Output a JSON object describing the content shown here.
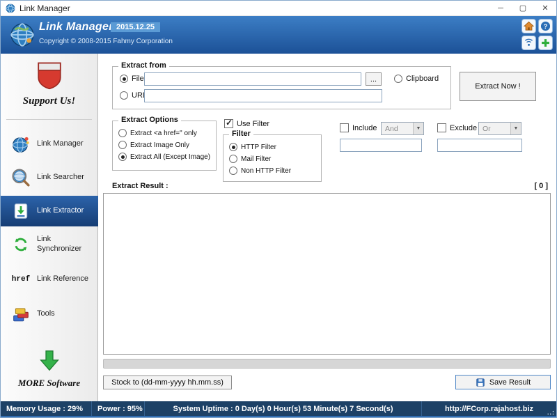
{
  "colors": {
    "header_top": "#3c7ec5",
    "header_bottom": "#1c5197",
    "selected_item": "#1f4d8c",
    "status_bar": "#1d4166",
    "version_badge": "#5b9bd5",
    "support_red": "#d63a2f",
    "arrow_green": "#35b24a"
  },
  "titlebar": {
    "title": "Link Manager",
    "minimize": "─",
    "maximize": "▢",
    "close": "✕"
  },
  "header": {
    "title": "Link Manager",
    "version": "2015.12.25",
    "copyright": "Copyright © 2008-2015 Fahmy Corporation"
  },
  "sidebar": {
    "support_label": "Support Us!",
    "href_glyph": "href",
    "items": [
      {
        "label": "Link Manager",
        "icon": "globe-icon",
        "selected": false
      },
      {
        "label": "Link Searcher",
        "icon": "magnifier-icon",
        "selected": false
      },
      {
        "label": "Link Extractor",
        "icon": "extract-icon",
        "selected": true
      },
      {
        "label": "Link Synchronizer",
        "icon": "sync-icon",
        "selected": false
      },
      {
        "label": "Link Reference",
        "icon": "href-icon",
        "selected": false
      },
      {
        "label": "Tools",
        "icon": "tools-icon",
        "selected": false
      }
    ],
    "more_label": "MORE Software"
  },
  "extract_from": {
    "legend": "Extract from",
    "file_label": "File",
    "file_value": "",
    "browse_label": "...",
    "url_label": "URL",
    "url_value": "",
    "clipboard_label": "Clipboard",
    "extract_now_label": "Extract Now !"
  },
  "extract_options": {
    "legend": "Extract Options",
    "options": [
      {
        "label": "Extract <a href=\" only",
        "selected": false
      },
      {
        "label": "Extract Image Only",
        "selected": false
      },
      {
        "label": "Extract All (Except Image)",
        "selected": true
      }
    ]
  },
  "filter": {
    "use_filter_label": "Use Filter",
    "use_filter_checked": true,
    "legend": "Filter",
    "options": [
      {
        "label": "HTTP Filter",
        "selected": true
      },
      {
        "label": "Mail Filter",
        "selected": false
      },
      {
        "label": "Non HTTP Filter",
        "selected": false
      }
    ]
  },
  "include": {
    "label": "Include",
    "operator": "And",
    "value": ""
  },
  "exclude": {
    "label": "Exclude",
    "operator": "Or",
    "value": ""
  },
  "result": {
    "label": "Extract Result :",
    "count": "[ 0 ]"
  },
  "actions": {
    "stock_label": "Stock to (dd-mm-yyyy hh.mm.ss)",
    "save_label": "Save Result"
  },
  "statusbar": {
    "memory": "Memory Usage : 29%",
    "power": "Power : 95%",
    "uptime": "System Uptime : 0 Day(s) 0 Hour(s) 53 Minute(s) 7 Second(s)",
    "url": "http://FCorp.rajahost.biz",
    "grip": "..:"
  }
}
